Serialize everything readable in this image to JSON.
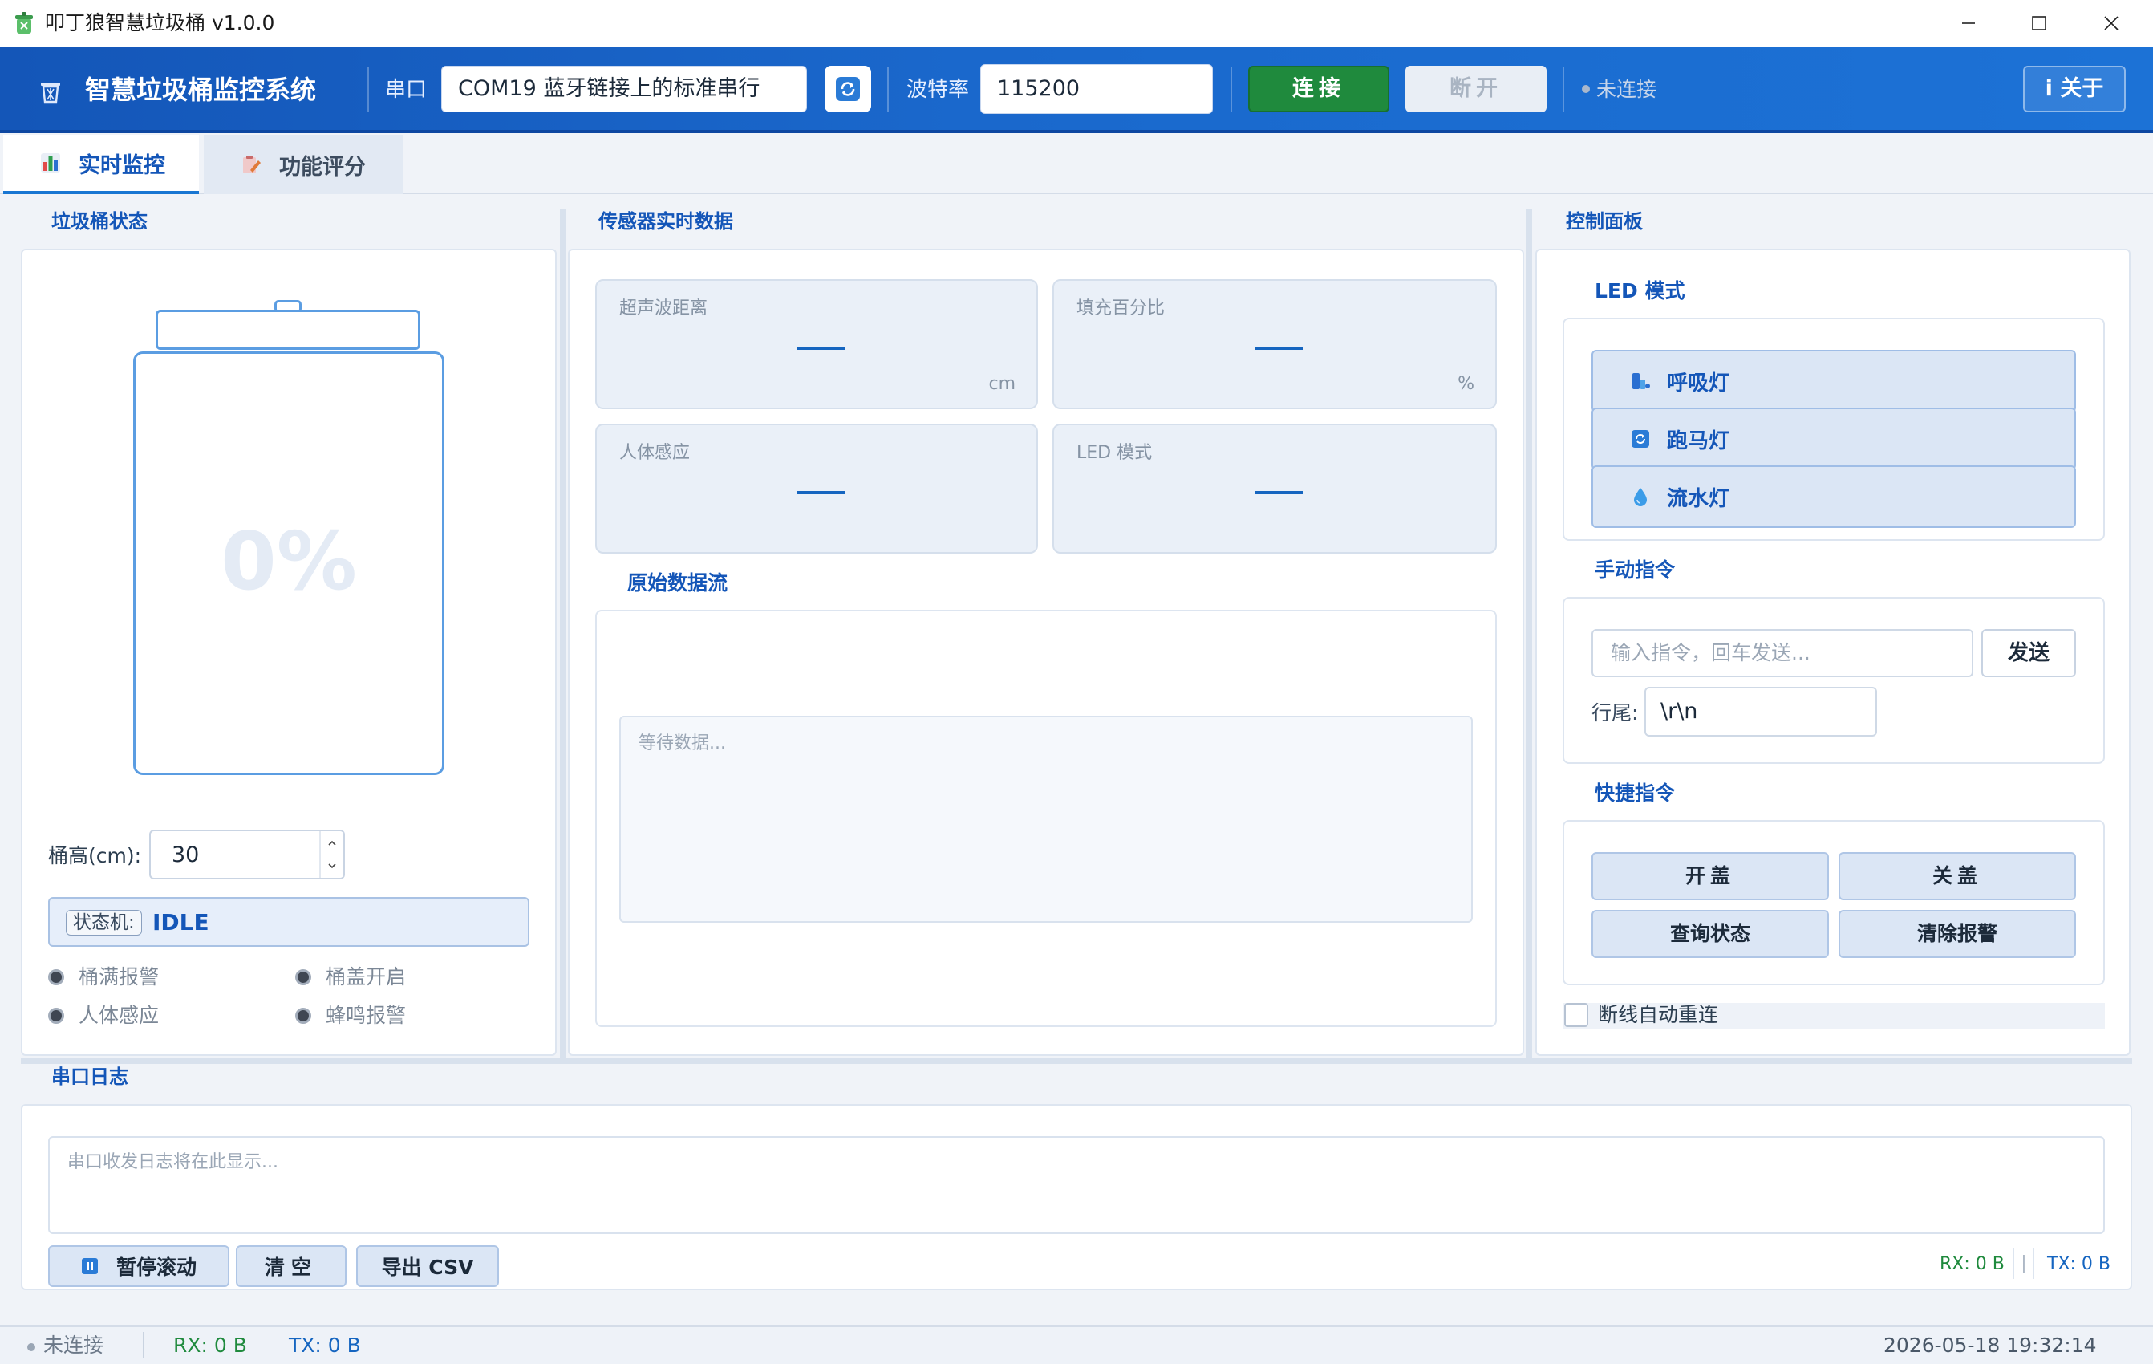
{
  "window": {
    "title": "叩丁狼智慧垃圾桶  v1.0.0"
  },
  "header": {
    "brand_title": "智慧垃圾桶监控系统",
    "port_label": "串口",
    "port_value": "COM19  蓝牙链接上的标准串行",
    "baud_label": "波特率",
    "baud_value": "115200",
    "connect_label": "连接",
    "disconnect_label": "断开",
    "status_text": "未连接",
    "about_label": "i  关于"
  },
  "tabs": [
    {
      "label": "实时监控",
      "icon": "bar-chart-icon",
      "active": true
    },
    {
      "label": "功能评分",
      "icon": "clipboard-pencil-icon",
      "active": false
    }
  ],
  "bin_panel": {
    "title": "垃圾桶状态",
    "fill_percent_text": "0%",
    "height_label": "桶高(cm):",
    "height_value": "30",
    "state_tag": "状态机:",
    "state_value": "IDLE",
    "indicators": [
      {
        "label": "桶满报警",
        "on": false
      },
      {
        "label": "桶盖开启",
        "on": false
      },
      {
        "label": "人体感应",
        "on": false
      },
      {
        "label": "蜂鸣报警",
        "on": false
      }
    ]
  },
  "sensor_panel": {
    "title": "传感器实时数据",
    "cards": [
      {
        "label": "超声波距离",
        "value": "—",
        "unit": "cm"
      },
      {
        "label": "填充百分比",
        "value": "—",
        "unit": "%"
      },
      {
        "label": "人体感应",
        "value": "—",
        "unit": ""
      },
      {
        "label": "LED 模式",
        "value": "—",
        "unit": ""
      }
    ],
    "raw_title": "原始数据流",
    "raw_placeholder": "等待数据..."
  },
  "control_panel": {
    "title": "控制面板",
    "led_title": "LED 模式",
    "led_modes": [
      {
        "label": "呼吸灯",
        "icon": "breathing-light-icon"
      },
      {
        "label": "跑马灯",
        "icon": "loop-refresh-icon"
      },
      {
        "label": "流水灯",
        "icon": "water-drop-icon"
      }
    ],
    "manual_title": "手动指令",
    "cmd_placeholder": "输入指令，回车发送...",
    "send_label": "发送",
    "eol_label": "行尾:",
    "eol_value": "\\r\\n",
    "quick_title": "快捷指令",
    "quick_cmds": [
      "开盖",
      "关盖",
      "查询状态",
      "清除报警"
    ],
    "auto_reconnect_label": "断线自动重连",
    "auto_reconnect_checked": false
  },
  "log_panel": {
    "title": "串口日志",
    "placeholder": "串口收发日志将在此显示...",
    "pause_label": "暂停滚动",
    "clear_label": "清空",
    "export_label": "导出 CSV",
    "rx": "RX: 0 B",
    "sep": "|",
    "tx": "TX: 0 B"
  },
  "statusbar": {
    "conn": "未连接",
    "rx": "RX: 0 B",
    "tx": "TX: 0 B",
    "datetime": "2026-05-18  19:32:14"
  },
  "colors": {
    "accent": "#1456b8",
    "header_bg": "#1a68cc",
    "connect_green": "#1f8a3d",
    "bin_outline": "#5b9de2"
  }
}
